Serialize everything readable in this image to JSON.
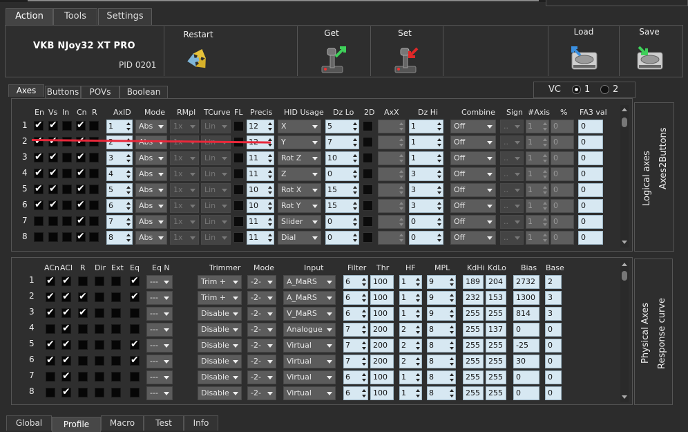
{
  "top_tabs": [
    "Action",
    "Tools",
    "Settings"
  ],
  "device": {
    "name": "VKB NJoy32 XT PRO",
    "pid": "PID 0201"
  },
  "toolbar": {
    "restart": "Restart",
    "get": "Get",
    "set": "Set",
    "load": "Load",
    "save": "Save"
  },
  "sub_tabs": [
    "Axes",
    "Buttons",
    "POVs",
    "Boolean"
  ],
  "vc": {
    "label": "VC",
    "opt1": "1",
    "opt2": "2",
    "selected": "1"
  },
  "logical": {
    "headers": {
      "en": "En",
      "vs": "Vs",
      "in": "In",
      "cn": "Cn",
      "r": "R",
      "axid": "AxID",
      "mode": "Mode",
      "rmpl": "RMpl",
      "tcurve": "TCurve",
      "fl": "FL",
      "precis": "Precis",
      "hid": "HID Usage",
      "dzlo": "Dz Lo",
      "d2": "2D",
      "axx": "AxX",
      "dzhi": "Dz Hi",
      "combine": "Combine",
      "sign": "Sign",
      "naxis": "#Axis",
      "pct": "%",
      "fa3": "FA3 val"
    },
    "rows": [
      {
        "n": "1",
        "en": true,
        "vs": true,
        "in": false,
        "cn": true,
        "r": false,
        "axid": "1",
        "mode": "Abs",
        "rmpl": "1x",
        "tcurve": "Lin",
        "precis": "12",
        "hid": "X",
        "dzlo": "5",
        "dzhi": "1",
        "combine": "Off",
        "sign": "..",
        "naxis": "1",
        "pct": "0",
        "fa3": "0"
      },
      {
        "n": "2",
        "en": true,
        "vs": true,
        "in": false,
        "cn": true,
        "r": false,
        "axid": "2",
        "mode": "Abs",
        "rmpl": "1x",
        "tcurve": "Lin",
        "precis": "12",
        "hid": "Y",
        "dzlo": "7",
        "dzhi": "1",
        "combine": "Off",
        "sign": "..",
        "naxis": "1",
        "pct": "0",
        "fa3": "0"
      },
      {
        "n": "3",
        "en": true,
        "vs": true,
        "in": false,
        "cn": true,
        "r": false,
        "axid": "3",
        "mode": "Abs",
        "rmpl": "1x",
        "tcurve": "Lin",
        "precis": "11",
        "hid": "Rot Z",
        "dzlo": "10",
        "dzhi": "1",
        "combine": "Off",
        "sign": "..",
        "naxis": "1",
        "pct": "0",
        "fa3": "0"
      },
      {
        "n": "4",
        "en": true,
        "vs": true,
        "in": false,
        "cn": true,
        "r": false,
        "axid": "4",
        "mode": "Abs",
        "rmpl": "1x",
        "tcurve": "Lin",
        "precis": "11",
        "hid": "Z",
        "dzlo": "0",
        "dzhi": "3",
        "combine": "Off",
        "sign": "..",
        "naxis": "1",
        "pct": "0",
        "fa3": "0"
      },
      {
        "n": "5",
        "en": true,
        "vs": true,
        "in": false,
        "cn": true,
        "r": false,
        "axid": "5",
        "mode": "Abs",
        "rmpl": "1x",
        "tcurve": "Lin",
        "precis": "10",
        "hid": "Rot X",
        "dzlo": "15",
        "dzhi": "3",
        "combine": "Off",
        "sign": "..",
        "naxis": "1",
        "pct": "0",
        "fa3": "0"
      },
      {
        "n": "6",
        "en": true,
        "vs": true,
        "in": false,
        "cn": true,
        "r": false,
        "axid": "6",
        "mode": "Abs",
        "rmpl": "1x",
        "tcurve": "Lin",
        "precis": "10",
        "hid": "Rot Y",
        "dzlo": "15",
        "dzhi": "3",
        "combine": "Off",
        "sign": "..",
        "naxis": "1",
        "pct": "0",
        "fa3": "0"
      },
      {
        "n": "7",
        "en": false,
        "vs": false,
        "in": false,
        "cn": true,
        "r": false,
        "axid": "7",
        "mode": "Abs",
        "rmpl": "1x",
        "tcurve": "Lin",
        "precis": "11",
        "hid": "Slider",
        "dzlo": "0",
        "dzhi": "0",
        "combine": "Off",
        "sign": "..",
        "naxis": "1",
        "pct": "0",
        "fa3": "0"
      },
      {
        "n": "8",
        "en": false,
        "vs": false,
        "in": false,
        "cn": true,
        "r": false,
        "axid": "8",
        "mode": "Abs",
        "rmpl": "1x",
        "tcurve": "Lin",
        "precis": "11",
        "hid": "Dial",
        "dzlo": "0",
        "dzhi": "0",
        "combine": "Off",
        "sign": "..",
        "naxis": "1",
        "pct": "0",
        "fa3": "0"
      }
    ],
    "side_title": "Logical axes",
    "side_sub": "Axes2Buttons"
  },
  "physical": {
    "headers": {
      "acn": "ACn",
      "acl": "ACl",
      "r": "R",
      "dir": "Dir",
      "ext": "Ext",
      "eq": "Eq",
      "eqn": "Eq N",
      "trimmer": "Trimmer",
      "mode": "Mode",
      "input": "Input",
      "filter": "Filter",
      "thr": "Thr",
      "hf": "HF",
      "mpl": "MPL",
      "kdhi": "KdHi",
      "kdlo": "KdLo",
      "bias": "Bias",
      "base": "Base"
    },
    "rows": [
      {
        "n": "1",
        "acn": true,
        "acl": true,
        "r": false,
        "dir": false,
        "ext": false,
        "eq": true,
        "eqn": "---",
        "trimmer": "Trim +",
        "mode": "-2-",
        "input": "A_MaRS",
        "filter": "6",
        "thr": "100",
        "hf": "1",
        "mpl": "9",
        "kdhi": "189",
        "kdlo": "204",
        "bias": "2732",
        "base": "2"
      },
      {
        "n": "2",
        "acn": true,
        "acl": true,
        "r": true,
        "dir": false,
        "ext": false,
        "eq": true,
        "eqn": "---",
        "trimmer": "Trim +",
        "mode": "-2-",
        "input": "A_MaRS",
        "filter": "6",
        "thr": "100",
        "hf": "1",
        "mpl": "9",
        "kdhi": "232",
        "kdlo": "153",
        "bias": "1300",
        "base": "3"
      },
      {
        "n": "3",
        "acn": true,
        "acl": true,
        "r": true,
        "dir": false,
        "ext": false,
        "eq": false,
        "eqn": "---",
        "trimmer": "Disable",
        "mode": "-2-",
        "input": "V_MaRS",
        "filter": "6",
        "thr": "100",
        "hf": "1",
        "mpl": "9",
        "kdhi": "255",
        "kdlo": "255",
        "bias": "814",
        "base": "3"
      },
      {
        "n": "4",
        "acn": false,
        "acl": true,
        "r": false,
        "dir": false,
        "ext": false,
        "eq": false,
        "eqn": "---",
        "trimmer": "Disable",
        "mode": "-2-",
        "input": "Analogue",
        "filter": "7",
        "thr": "200",
        "hf": "2",
        "mpl": "8",
        "kdhi": "255",
        "kdlo": "137",
        "bias": "0",
        "base": "0"
      },
      {
        "n": "5",
        "acn": true,
        "acl": true,
        "r": false,
        "dir": false,
        "ext": false,
        "eq": true,
        "eqn": "---",
        "trimmer": "Disable",
        "mode": "-2-",
        "input": "Virtual",
        "filter": "7",
        "thr": "200",
        "hf": "2",
        "mpl": "8",
        "kdhi": "255",
        "kdlo": "255",
        "bias": "-25",
        "base": "0"
      },
      {
        "n": "6",
        "acn": true,
        "acl": true,
        "r": false,
        "dir": false,
        "ext": false,
        "eq": true,
        "eqn": "---",
        "trimmer": "Disable",
        "mode": "-2-",
        "input": "Virtual",
        "filter": "7",
        "thr": "200",
        "hf": "2",
        "mpl": "8",
        "kdhi": "255",
        "kdlo": "255",
        "bias": "30",
        "base": "0"
      },
      {
        "n": "7",
        "acn": false,
        "acl": true,
        "r": false,
        "dir": false,
        "ext": false,
        "eq": false,
        "eqn": "---",
        "trimmer": "Disable",
        "mode": "-2-",
        "input": "Virtual",
        "filter": "6",
        "thr": "100",
        "hf": "1",
        "mpl": "8",
        "kdhi": "255",
        "kdlo": "255",
        "bias": "0",
        "base": "0"
      },
      {
        "n": "8",
        "acn": false,
        "acl": true,
        "r": false,
        "dir": false,
        "ext": false,
        "eq": false,
        "eqn": "---",
        "trimmer": "Disable",
        "mode": "-2-",
        "input": "Virtual",
        "filter": "6",
        "thr": "100",
        "hf": "1",
        "mpl": "8",
        "kdhi": "255",
        "kdlo": "255",
        "bias": "0",
        "base": "0"
      }
    ],
    "side_title": "Physical Axes",
    "side_sub": "Response curve"
  },
  "bottom_tabs": [
    "Global",
    "Profile",
    "Macro",
    "Test",
    "Info"
  ],
  "colors": {
    "accent_line": "#e8283a",
    "field_bg": "#d7e8f2"
  },
  "icons": {
    "restart": "recycle-arrows-icon",
    "get": "joystick-get-icon",
    "set": "joystick-set-icon",
    "load": "hdd-load-icon",
    "save": "hdd-save-icon"
  }
}
